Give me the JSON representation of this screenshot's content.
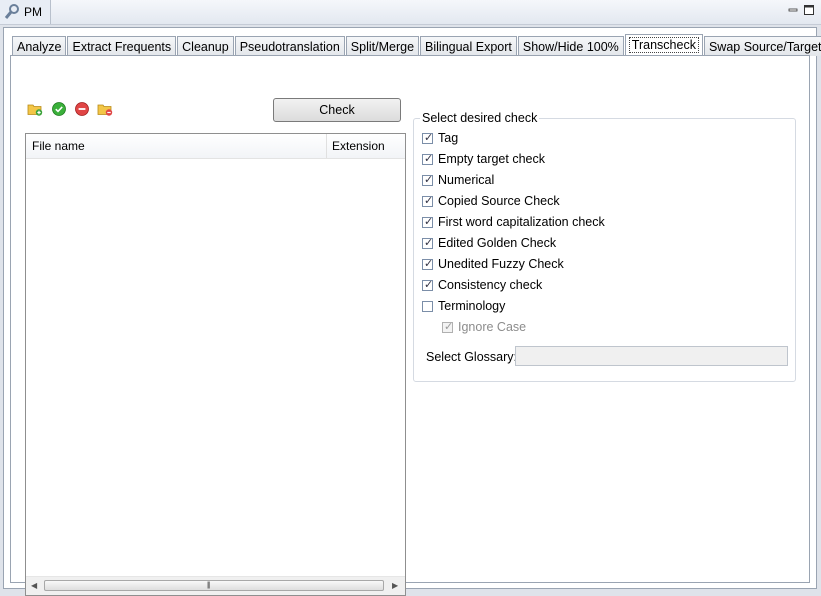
{
  "window": {
    "title": "PM"
  },
  "tabs": [
    {
      "label": "Analyze"
    },
    {
      "label": "Extract Frequents"
    },
    {
      "label": "Cleanup"
    },
    {
      "label": "Pseudotranslation"
    },
    {
      "label": "Split/Merge"
    },
    {
      "label": "Bilingual Export"
    },
    {
      "label": "Show/Hide 100%"
    },
    {
      "label": "Transcheck"
    },
    {
      "label": "Swap Source/Target"
    }
  ],
  "active_tab": "Transcheck",
  "toolbar": {
    "icons": [
      "add-folder-icon",
      "check-icon",
      "remove-icon",
      "remove-folder-icon"
    ],
    "check_label": "Check"
  },
  "file_table": {
    "columns": [
      "File name",
      "Extension"
    ],
    "rows": []
  },
  "checks": {
    "legend": "Select desired check",
    "items": [
      {
        "label": "Tag",
        "checked": true
      },
      {
        "label": "Empty target check",
        "checked": true
      },
      {
        "label": "Numerical",
        "checked": true
      },
      {
        "label": "Copied Source Check",
        "checked": true
      },
      {
        "label": "First word capitalization check",
        "checked": true
      },
      {
        "label": "Edited Golden Check",
        "checked": true
      },
      {
        "label": "Unedited Fuzzy Check",
        "checked": true
      },
      {
        "label": "Consistency check",
        "checked": true
      },
      {
        "label": "Terminology",
        "checked": false
      }
    ],
    "ignore_case": {
      "label": "Ignore Case",
      "checked": true,
      "disabled": true
    },
    "glossary_label": "Select Glossary:",
    "glossary_value": ""
  }
}
